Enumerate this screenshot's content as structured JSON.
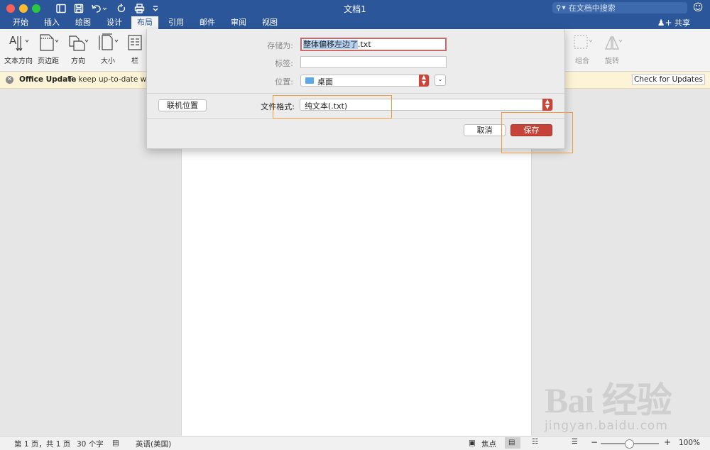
{
  "window": {
    "title": "文档1",
    "search_placeholder": "在文档中搜索",
    "share_label": "共享"
  },
  "tabs": [
    {
      "label": "开始",
      "active": false
    },
    {
      "label": "插入",
      "active": false
    },
    {
      "label": "绘图",
      "active": false
    },
    {
      "label": "设计",
      "active": false
    },
    {
      "label": "布局",
      "active": true
    },
    {
      "label": "引用",
      "active": false
    },
    {
      "label": "邮件",
      "active": false
    },
    {
      "label": "审阅",
      "active": false
    },
    {
      "label": "视图",
      "active": false
    }
  ],
  "ribbon": {
    "text_direction": "文本方向",
    "margins": "页边距",
    "orientation": "方向",
    "size": "大小",
    "columns": "栏",
    "group": "组合",
    "rotate": "旋转"
  },
  "infobar": {
    "title": "Office Update",
    "message": "To keep up-to-date with",
    "button": "Check for Updates"
  },
  "dialog": {
    "save_as_label": "存储为:",
    "file_name_selected": "整体偏移左边了",
    "file_extension": ".txt",
    "tags_label": "标签:",
    "tags_value": "",
    "location_label": "位置:",
    "location_value": "桌面",
    "online_locations_button": "联机位置",
    "file_format_label": "文件格式:",
    "file_format_value": "纯文本(.txt)",
    "cancel_button": "取消",
    "save_button": "保存"
  },
  "status": {
    "page": "第 1 页，共 1 页",
    "words": "30 个字",
    "language": "英语(美国)",
    "focus": "焦点",
    "zoom": "100%"
  },
  "watermark": {
    "brand_text": "Bai 经验",
    "url": "jingyan.baidu.com"
  },
  "colors": {
    "title_bar": "#2b579a",
    "accent_button": "#c6433a",
    "highlight": "#f39c3c"
  },
  "zoom_level_percent": 100
}
